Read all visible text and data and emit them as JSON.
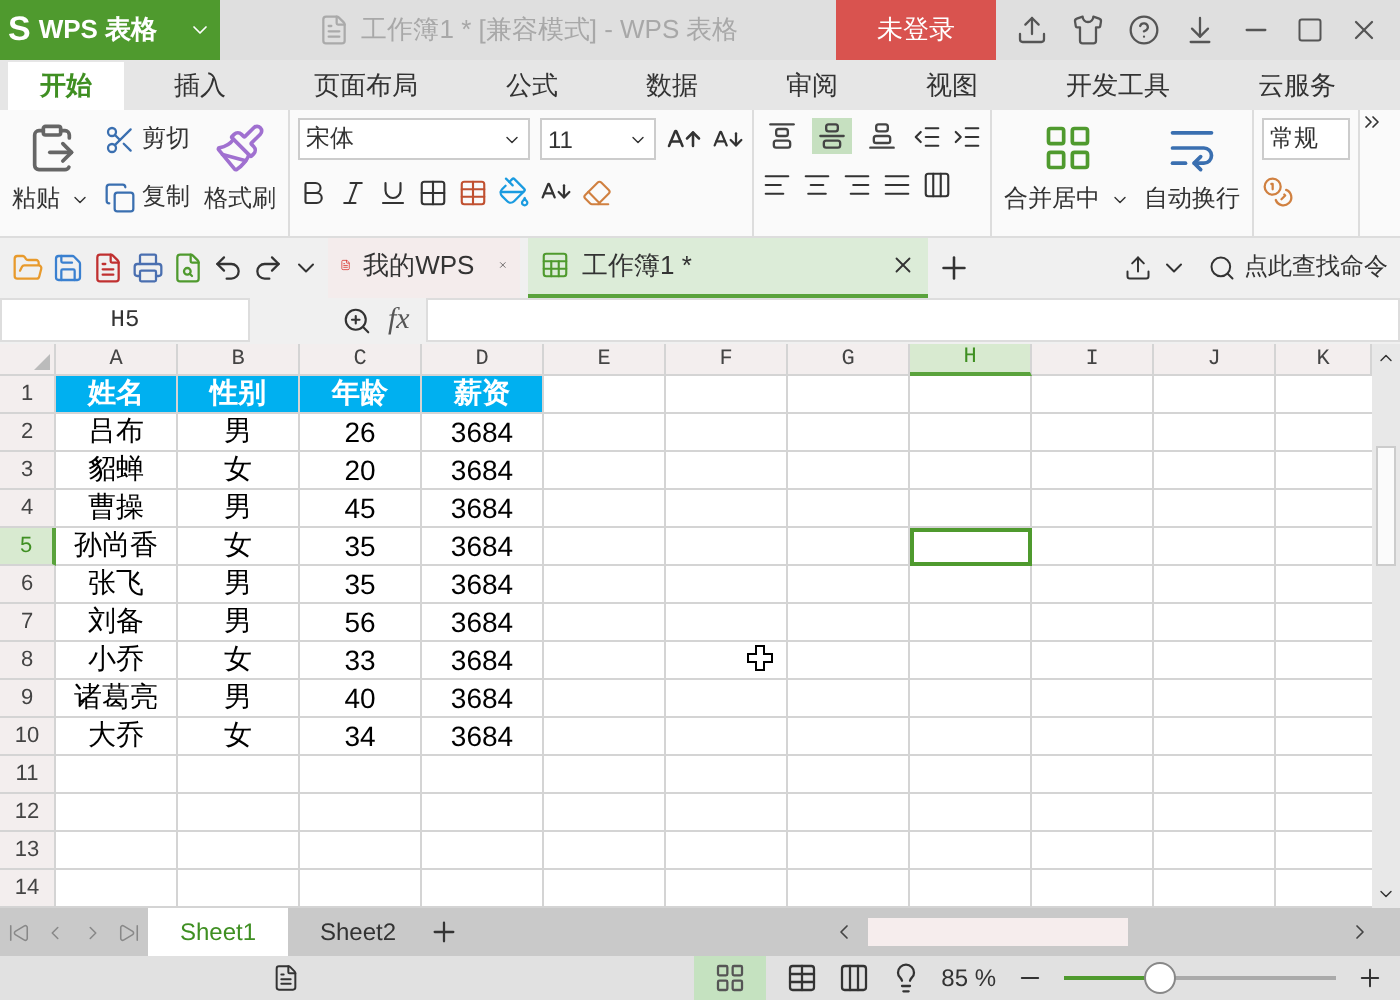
{
  "app": {
    "logo": "S",
    "name": "WPS 表格"
  },
  "window": {
    "title": "工作簿1 * [兼容模式] - WPS 表格",
    "login": "未登录"
  },
  "menu_tabs": [
    {
      "label": "开始",
      "selected": true
    },
    {
      "label": "插入",
      "selected": false
    },
    {
      "label": "页面布局",
      "selected": false
    },
    {
      "label": "公式",
      "selected": false
    },
    {
      "label": "数据",
      "selected": false
    },
    {
      "label": "审阅",
      "selected": false
    },
    {
      "label": "视图",
      "selected": false
    },
    {
      "label": "开发工具",
      "selected": false
    },
    {
      "label": "云服务",
      "selected": false
    }
  ],
  "ribbon": {
    "paste": "粘贴",
    "cut": "剪切",
    "copy": "复制",
    "format_painter": "格式刷",
    "font_name": "宋体",
    "font_size": "11",
    "merge": "合并居中",
    "wrap": "自动换行",
    "number_format": "常规",
    "align_buttons": [
      {
        "kind": "top",
        "selected": false
      },
      {
        "kind": "middle",
        "selected": true
      },
      {
        "kind": "bottom",
        "selected": false
      }
    ]
  },
  "doc_tabs": [
    {
      "label": "我的WPS",
      "kind": "home",
      "selected": false
    },
    {
      "label": "工作簿1 *",
      "kind": "sheet",
      "selected": true
    }
  ],
  "command_search": {
    "placeholder": "点此查找命令"
  },
  "formula_bar": {
    "name_box": "H5",
    "fx": "fx"
  },
  "sheet": {
    "columns": [
      {
        "label": "A",
        "selected": false
      },
      {
        "label": "B",
        "selected": false
      },
      {
        "label": "C",
        "selected": false
      },
      {
        "label": "D",
        "selected": false
      },
      {
        "label": "E",
        "selected": false
      },
      {
        "label": "F",
        "selected": false
      },
      {
        "label": "G",
        "selected": false
      },
      {
        "label": "H",
        "selected": true
      },
      {
        "label": "I",
        "selected": false
      },
      {
        "label": "J",
        "selected": false
      },
      {
        "label": "K",
        "selected": false
      }
    ],
    "rows": [
      {
        "number": "1",
        "kind": "header",
        "selected": false,
        "cells": [
          "姓名",
          "性别",
          "年龄",
          "薪资"
        ]
      },
      {
        "number": "2",
        "kind": "data",
        "selected": false,
        "cells": [
          "吕布",
          "男",
          "26",
          "3684"
        ]
      },
      {
        "number": "3",
        "kind": "data",
        "selected": false,
        "cells": [
          "貂蝉",
          "女",
          "20",
          "3684"
        ]
      },
      {
        "number": "4",
        "kind": "data",
        "selected": false,
        "cells": [
          "曹操",
          "男",
          "45",
          "3684"
        ]
      },
      {
        "number": "5",
        "kind": "data",
        "selected": true,
        "cells": [
          "孙尚香",
          "女",
          "35",
          "3684"
        ]
      },
      {
        "number": "6",
        "kind": "data",
        "selected": false,
        "cells": [
          "张飞",
          "男",
          "35",
          "3684"
        ]
      },
      {
        "number": "7",
        "kind": "data",
        "selected": false,
        "cells": [
          "刘备",
          "男",
          "56",
          "3684"
        ]
      },
      {
        "number": "8",
        "kind": "data",
        "selected": false,
        "cells": [
          "小乔",
          "女",
          "33",
          "3684"
        ]
      },
      {
        "number": "9",
        "kind": "data",
        "selected": false,
        "cells": [
          "诸葛亮",
          "男",
          "40",
          "3684"
        ]
      },
      {
        "number": "10",
        "kind": "data",
        "selected": false,
        "cells": [
          "大乔",
          "女",
          "34",
          "3684"
        ]
      },
      {
        "number": "11",
        "kind": "data",
        "selected": false,
        "cells": []
      },
      {
        "number": "12",
        "kind": "data",
        "selected": false,
        "cells": []
      },
      {
        "number": "13",
        "kind": "data",
        "selected": false,
        "cells": []
      },
      {
        "number": "14",
        "kind": "data",
        "selected": false,
        "cells": []
      }
    ]
  },
  "sheet_tabs": [
    {
      "label": "Sheet1",
      "selected": true
    },
    {
      "label": "Sheet2",
      "selected": false
    }
  ],
  "status_bar": {
    "zoom": "85 %",
    "level": 0.35
  }
}
